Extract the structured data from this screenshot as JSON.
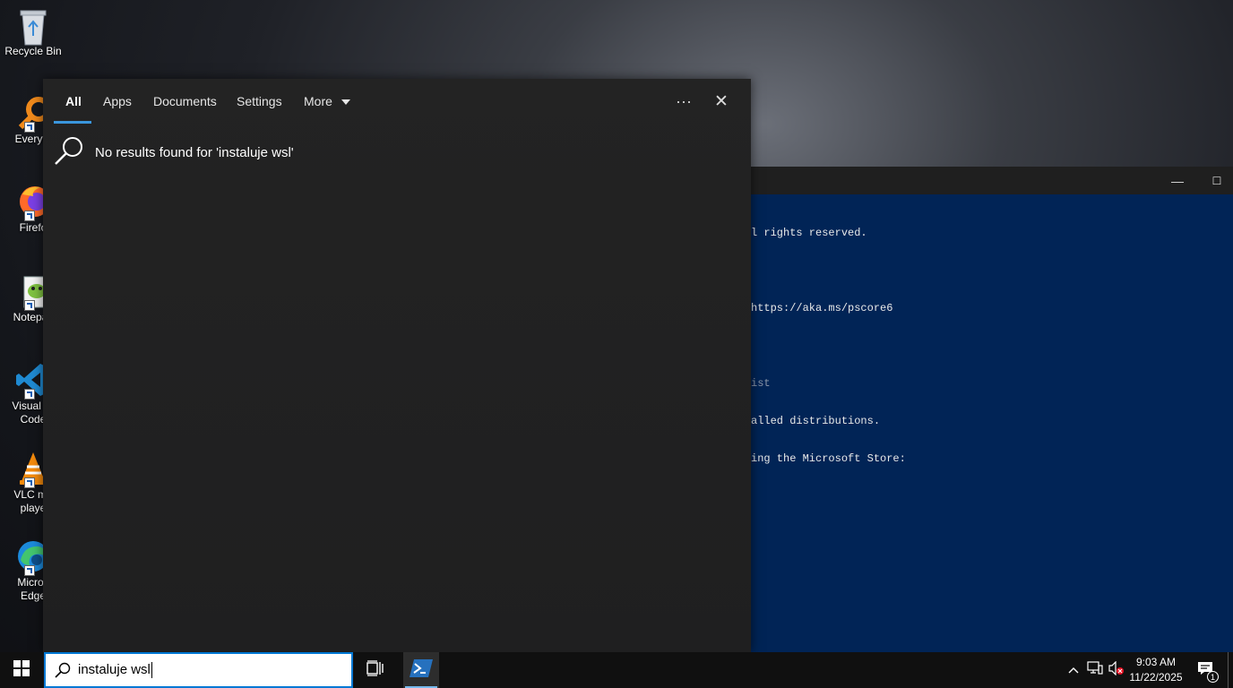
{
  "desktop": {
    "icons": [
      {
        "label": "Recycle Bin",
        "icon": "recycle-bin-icon"
      },
      {
        "label": "Everyth",
        "icon": "everything-search-icon"
      },
      {
        "label": "Firefo",
        "icon": "firefox-icon"
      },
      {
        "label": "Notepac",
        "icon": "notepad-plus-plus-icon"
      },
      {
        "label": "Visual St",
        "label2": "Code",
        "icon": "vscode-icon"
      },
      {
        "label": "VLC me",
        "label2": "playe",
        "icon": "vlc-icon"
      },
      {
        "label": "Micros",
        "label2": "Edge",
        "icon": "edge-icon"
      }
    ]
  },
  "terminal": {
    "lines": [
      {
        "text": "l rights reserved.",
        "dim": false
      },
      {
        "text": "",
        "dim": false
      },
      {
        "text": "https://aka.ms/pscore6",
        "dim": false
      },
      {
        "text": "",
        "dim": false
      },
      {
        "text": "ist",
        "dim": true
      },
      {
        "text": "alled distributions.",
        "dim": false
      },
      {
        "text": "ing the Microsoft Store:",
        "dim": false
      }
    ],
    "minimize_glyph": "—",
    "maximize_glyph": "☐"
  },
  "search_panel": {
    "tabs": [
      {
        "label": "All",
        "active": true
      },
      {
        "label": "Apps",
        "active": false
      },
      {
        "label": "Documents",
        "active": false
      },
      {
        "label": "Settings",
        "active": false
      },
      {
        "label": "More",
        "active": false
      }
    ],
    "more_options_glyph": "···",
    "close_glyph": "✕",
    "no_results_text": "No results found for 'instaluje wsl'"
  },
  "taskbar": {
    "search_query": "instaluje wsl",
    "clock": {
      "time": "9:03 AM",
      "date": "11/22/2025"
    },
    "notification_count": "1"
  },
  "colors": {
    "accent": "#0078d4",
    "terminal_bg": "#012456",
    "tab_underline": "#3a96dd"
  }
}
